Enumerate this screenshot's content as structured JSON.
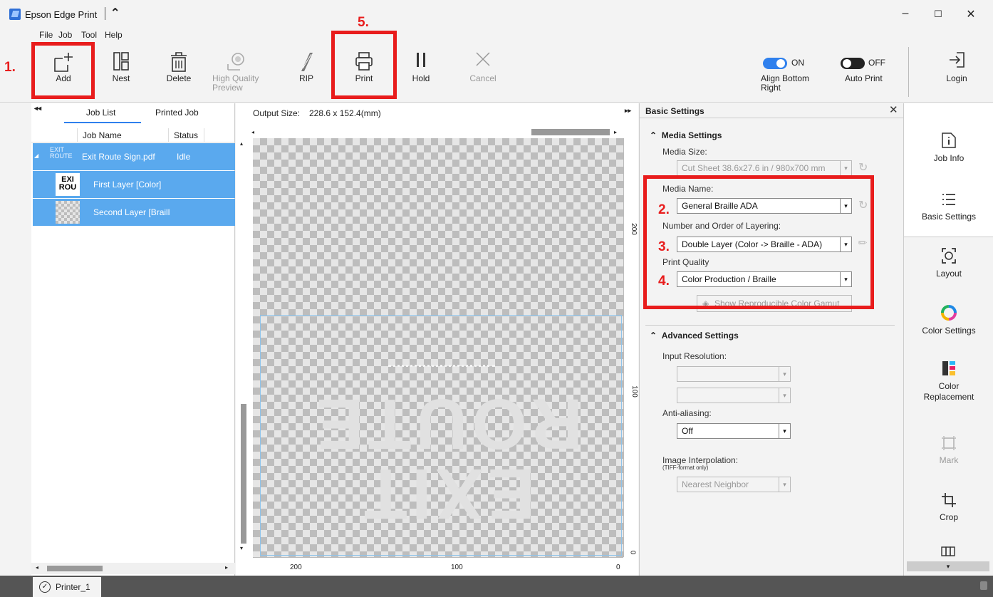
{
  "window": {
    "title": "Epson Edge Print",
    "minimize": "–",
    "maximize": "☐",
    "close": "✕",
    "collapse": "⌃"
  },
  "menu": [
    {
      "label": "File"
    },
    {
      "label": "Job"
    },
    {
      "label": "Tool"
    },
    {
      "label": "Help"
    }
  ],
  "toolbar": {
    "add": "Add",
    "nest": "Nest",
    "delete": "Delete",
    "hq_preview": "High Quality Preview",
    "rip": "RIP",
    "print": "Print",
    "hold": "Hold",
    "cancel": "Cancel",
    "align_bottom_right": {
      "state": "ON",
      "label": "Align Bottom Right"
    },
    "auto_print": {
      "state": "OFF",
      "label": "Auto Print"
    },
    "login": "Login"
  },
  "left_panel": {
    "tabs": [
      "Job List",
      "Printed Job"
    ],
    "columns": [
      "Job Name",
      "Status"
    ],
    "jobs": [
      {
        "name": "Exit Route Sign.pdf",
        "status": "Idle",
        "thumb_text": "EXIT ROUTE"
      },
      {
        "name": "First Layer [Color]",
        "thumb_text": "EXI ROU"
      },
      {
        "name": "Second Layer [Braill"
      }
    ]
  },
  "canvas": {
    "output_size_label": "Output Size:",
    "output_size": "228.6 x 152.4(mm)",
    "ruler_v": [
      "200",
      "100",
      "0"
    ],
    "ruler_h": [
      "200",
      "100",
      "0"
    ],
    "sign_text": "EXIT ROUTE"
  },
  "settings": {
    "title": "Basic Settings",
    "media_section": "Media Settings",
    "media_size_label": "Media Size:",
    "media_size": "Cut Sheet 38.6x27.6 in / 980x700 mm",
    "media_name_label": "Media Name:",
    "media_name": "General Braille ADA",
    "layering_label": "Number and Order of Layering:",
    "layering": "Double Layer (Color -> Braille - ADA)",
    "quality_label": "Print Quality",
    "quality": "Color Production / Braille",
    "gamut_button": "Show Reproducible Color Gamut",
    "advanced_section": "Advanced Settings",
    "input_resolution_label": "Input Resolution:",
    "anti_aliasing_label": "Anti-aliasing:",
    "anti_aliasing": "Off",
    "interp_label": "Image Interpolation:",
    "interp_note": "(TIFF-format only)",
    "interp": "Nearest Neighbor"
  },
  "side_nav": [
    "Job Info",
    "Basic Settings",
    "Layout",
    "Color Settings",
    "Color Replacement",
    "Mark",
    "Crop"
  ],
  "status": {
    "printer": "Printer_1"
  },
  "annotations": [
    "1.",
    "2.",
    "3.",
    "4.",
    "5."
  ],
  "colors": {
    "accent": "#5aa9ee",
    "highlight": "#e81c1c",
    "toggle_on": "#2f80ed",
    "toggle_off": "#222222"
  }
}
